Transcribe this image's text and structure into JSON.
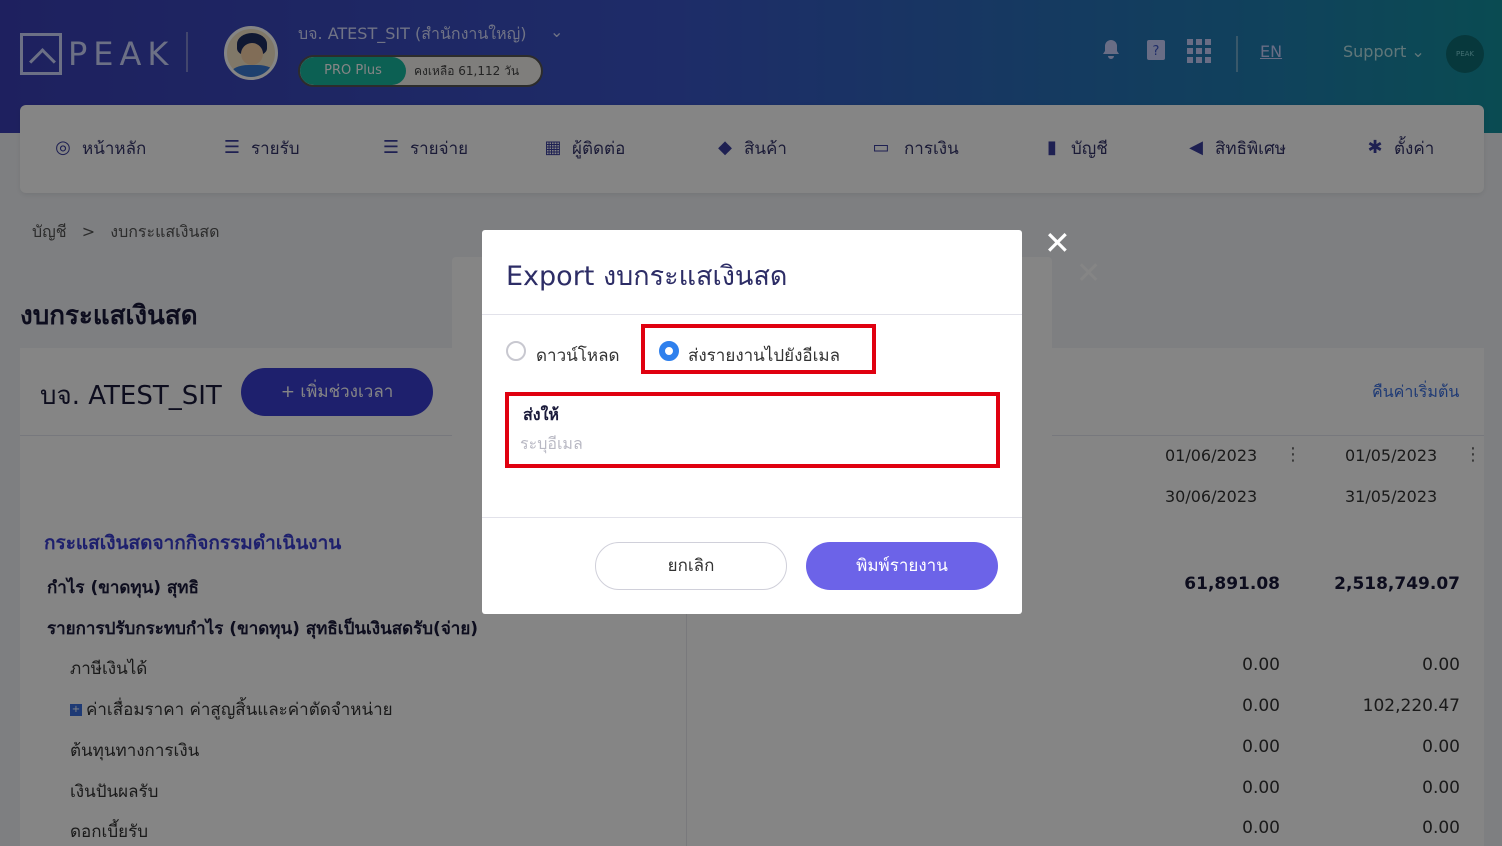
{
  "header": {
    "logo_text": "PEAK",
    "company_name": "บจ. ATEST_SIT (สำนักงานใหญ่)",
    "plan_badge": "PRO Plus",
    "plan_remaining": "คงเหลือ 61,112 วัน",
    "lang": "EN",
    "support": "Support",
    "support_avatar": "PEAK"
  },
  "nav": {
    "items": [
      {
        "label": "หน้าหลัก",
        "icon": "dashboard-icon"
      },
      {
        "label": "รายรับ",
        "icon": "income-icon"
      },
      {
        "label": "รายจ่าย",
        "icon": "expense-icon"
      },
      {
        "label": "ผู้ติดต่อ",
        "icon": "contacts-icon"
      },
      {
        "label": "สินค้า",
        "icon": "product-box-icon"
      },
      {
        "label": "การเงิน",
        "icon": "money-icon"
      },
      {
        "label": "บัญชี",
        "icon": "ledger-icon"
      },
      {
        "label": "สิทธิพิเศษ",
        "icon": "megaphone-icon"
      },
      {
        "label": "ตั้งค่า",
        "icon": "gear-icon"
      }
    ]
  },
  "breadcrumb": {
    "root": "บัญชี",
    "separator": ">",
    "current": "งบกระแสเงินสด"
  },
  "page": {
    "title": "งบกระแสเงินสด",
    "company": "บจ. ATEST_SIT",
    "add_period": "+ เพิ่มช่วงเวลา",
    "reset": "คืนค่าเริ่มต้น",
    "columns": [
      {
        "from": "01/06/2023",
        "to": "30/06/2023"
      },
      {
        "from": "01/05/2023",
        "to": "31/05/2023"
      }
    ],
    "section_title": "กระแสเงินสดจากกิจกรรมดำเนินงาน",
    "rows": [
      {
        "label": "กำไร (ขาดทุน) สุทธิ",
        "v1": "61,891.08",
        "v2": "2,518,749.07"
      },
      {
        "label": "รายการปรับกระทบกำไร (ขาดทุน) สุทธิเป็นเงินสดรับ(จ่าย)",
        "v1": "",
        "v2": ""
      },
      {
        "label": "ภาษีเงินได้",
        "v1": "0.00",
        "v2": "0.00"
      },
      {
        "label": "ค่าเสื่อมราคา ค่าสูญสิ้นและค่าตัดจำหน่าย",
        "v1": "0.00",
        "v2": "102,220.47"
      },
      {
        "label": "ต้นทุนทางการเงิน",
        "v1": "0.00",
        "v2": "0.00"
      },
      {
        "label": "เงินปันผลรับ",
        "v1": "0.00",
        "v2": "0.00"
      },
      {
        "label": "ดอกเบี้ยรับ",
        "v1": "0.00",
        "v2": "0.00"
      }
    ]
  },
  "modal": {
    "title": "Export งบกระแสเงินสด",
    "option_download": "ดาวน์โหลด",
    "option_email": "ส่งรายงานไปยังอีเมล",
    "selected_option": "email",
    "field_label": "ส่งให้",
    "field_value": "",
    "field_placeholder": "ระบุอีเมล",
    "cancel": "ยกเลิก",
    "print": "พิมพ์รายงาน",
    "close": "✕",
    "highlight_color": "#e00010",
    "print_color": "#6c63e8"
  }
}
